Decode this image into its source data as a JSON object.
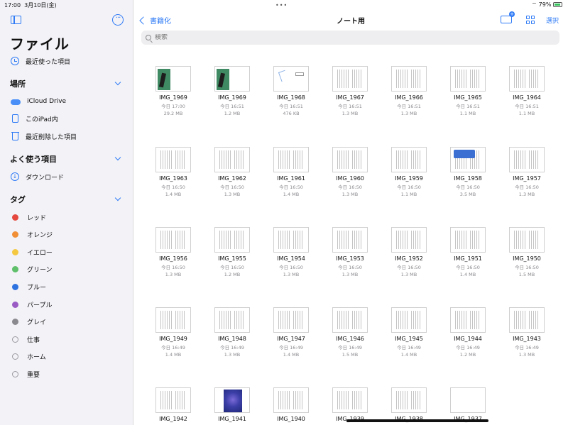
{
  "status": {
    "time": "17:00",
    "date": "3月10日(金)",
    "battery": "79%"
  },
  "sidebar": {
    "title": "ファイル",
    "recents": "最近使った項目",
    "sections": {
      "locations": "場所",
      "favorites": "よく使う項目",
      "tags": "タグ"
    },
    "locations": [
      "iCloud Drive",
      "このiPad内",
      "最近削除した項目"
    ],
    "favorites": [
      "ダウンロード"
    ],
    "tags": [
      {
        "label": "レッド",
        "color": "#e5483e"
      },
      {
        "label": "オレンジ",
        "color": "#f08f35"
      },
      {
        "label": "イエロー",
        "color": "#f5c842"
      },
      {
        "label": "グリーン",
        "color": "#5fbf6a"
      },
      {
        "label": "ブルー",
        "color": "#2f73e0"
      },
      {
        "label": "パープル",
        "color": "#9a5cc4"
      },
      {
        "label": "グレイ",
        "color": "#8a8a8f"
      },
      {
        "label": "仕事",
        "color": ""
      },
      {
        "label": "ホーム",
        "color": ""
      },
      {
        "label": "重要",
        "color": ""
      }
    ]
  },
  "nav": {
    "back": "書籍化",
    "title": "ノート用",
    "select": "選択"
  },
  "search": {
    "placeholder": "検索"
  },
  "files": [
    {
      "name": "IMG_1969",
      "date": "今日 17:00",
      "size": "29.2 MB",
      "thumb": "book"
    },
    {
      "name": "IMG_1969",
      "date": "今日 16:51",
      "size": "1.2 MB",
      "thumb": "book"
    },
    {
      "name": "IMG_1968",
      "date": "今日 16:51",
      "size": "476 KB",
      "thumb": "sketch"
    },
    {
      "name": "IMG_1967",
      "date": "今日 16:51",
      "size": "1.3 MB",
      "thumb": "text"
    },
    {
      "name": "IMG_1966",
      "date": "今日 16:51",
      "size": "1.3 MB",
      "thumb": "text"
    },
    {
      "name": "IMG_1965",
      "date": "今日 16:51",
      "size": "1.1 MB",
      "thumb": "text"
    },
    {
      "name": "IMG_1964",
      "date": "今日 16:51",
      "size": "1.1 MB",
      "thumb": "text"
    },
    {
      "name": "IMG_1963",
      "date": "今日 16:50",
      "size": "1.4 MB",
      "thumb": "text"
    },
    {
      "name": "IMG_1962",
      "date": "今日 16:50",
      "size": "1.3 MB",
      "thumb": "text"
    },
    {
      "name": "IMG_1961",
      "date": "今日 16:50",
      "size": "1.4 MB",
      "thumb": "text"
    },
    {
      "name": "IMG_1960",
      "date": "今日 16:50",
      "size": "1.3 MB",
      "thumb": "text"
    },
    {
      "name": "IMG_1959",
      "date": "今日 16:50",
      "size": "1.1 MB",
      "thumb": "text"
    },
    {
      "name": "IMG_1958",
      "date": "今日 16:50",
      "size": "3.5 MB",
      "thumb": "blue"
    },
    {
      "name": "IMG_1957",
      "date": "今日 16:50",
      "size": "1.3 MB",
      "thumb": "text"
    },
    {
      "name": "IMG_1956",
      "date": "今日 16:50",
      "size": "1.3 MB",
      "thumb": "text"
    },
    {
      "name": "IMG_1955",
      "date": "今日 16:50",
      "size": "1.2 MB",
      "thumb": "text"
    },
    {
      "name": "IMG_1954",
      "date": "今日 16:50",
      "size": "1.3 MB",
      "thumb": "text"
    },
    {
      "name": "IMG_1953",
      "date": "今日 16:50",
      "size": "1.3 MB",
      "thumb": "text"
    },
    {
      "name": "IMG_1952",
      "date": "今日 16:50",
      "size": "1.3 MB",
      "thumb": "text"
    },
    {
      "name": "IMG_1951",
      "date": "今日 16:50",
      "size": "1.4 MB",
      "thumb": "text"
    },
    {
      "name": "IMG_1950",
      "date": "今日 16:50",
      "size": "1.5 MB",
      "thumb": "text"
    },
    {
      "name": "IMG_1949",
      "date": "今日 16:49",
      "size": "1.4 MB",
      "thumb": "text"
    },
    {
      "name": "IMG_1948",
      "date": "今日 16:49",
      "size": "1.3 MB",
      "thumb": "text"
    },
    {
      "name": "IMG_1947",
      "date": "今日 16:49",
      "size": "1.4 MB",
      "thumb": "text"
    },
    {
      "name": "IMG_1946",
      "date": "今日 16:49",
      "size": "1.5 MB",
      "thumb": "text"
    },
    {
      "name": "IMG_1945",
      "date": "今日 16:49",
      "size": "1.4 MB",
      "thumb": "text"
    },
    {
      "name": "IMG_1944",
      "date": "今日 16:49",
      "size": "1.2 MB",
      "thumb": "text"
    },
    {
      "name": "IMG_1943",
      "date": "今日 16:49",
      "size": "1.3 MB",
      "thumb": "text"
    },
    {
      "name": "IMG_1942",
      "date": "",
      "size": "",
      "thumb": "text"
    },
    {
      "name": "IMG_1941",
      "date": "",
      "size": "",
      "thumb": "poster"
    },
    {
      "name": "IMG_1940",
      "date": "",
      "size": "",
      "thumb": "text"
    },
    {
      "name": "IMG_1939",
      "date": "",
      "size": "",
      "thumb": "text"
    },
    {
      "name": "IMG_1938",
      "date": "",
      "size": "",
      "thumb": "text"
    },
    {
      "name": "IMG_1937",
      "date": "",
      "size": "",
      "thumb": "blank"
    }
  ]
}
